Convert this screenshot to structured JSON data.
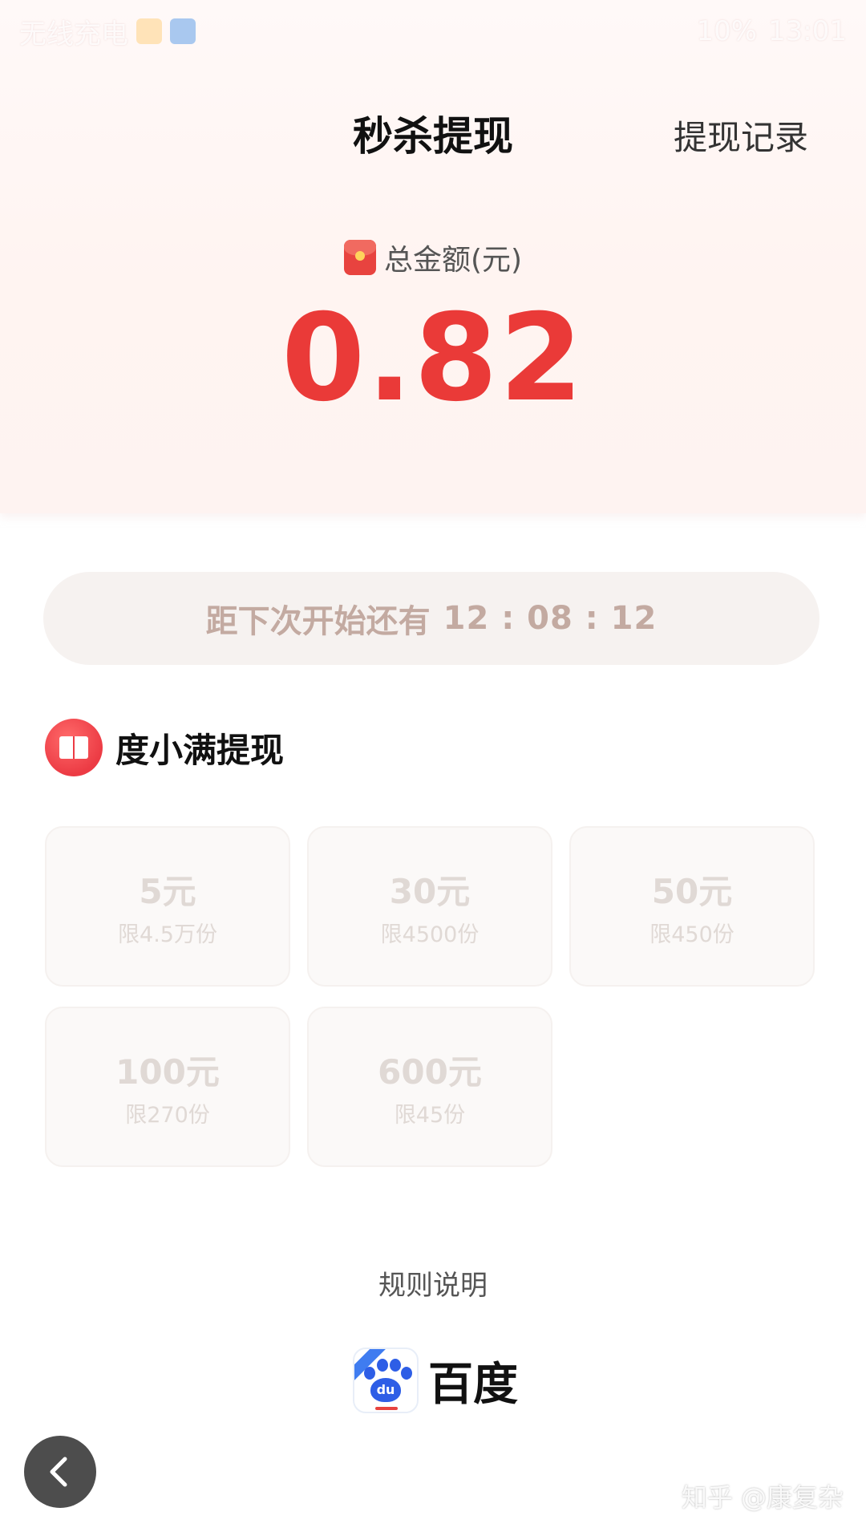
{
  "status_bar": {
    "left_text": "无线充电",
    "right_text": "10%",
    "time": "13:01"
  },
  "header": {
    "title": "秒杀提现",
    "record_link": "提现记录"
  },
  "balance": {
    "label": "总金额(元)",
    "amount": "0.82"
  },
  "countdown": {
    "prefix": "距下次开始还有",
    "time": "12 : 08 : 12"
  },
  "section": {
    "title": "度小满提现"
  },
  "options": [
    {
      "amount": "5元",
      "limit": "限4.5万份"
    },
    {
      "amount": "30元",
      "limit": "限4500份"
    },
    {
      "amount": "50元",
      "limit": "限450份"
    },
    {
      "amount": "100元",
      "limit": "限270份"
    },
    {
      "amount": "600元",
      "limit": "限45份"
    }
  ],
  "footer": {
    "rules": "规则说明",
    "brand": "百度",
    "brand_icon_text": "du",
    "watermark": "知乎 @康复杂"
  },
  "colors": {
    "accent_red": "#ea3a38",
    "countdown_text": "#c3aaa1",
    "disabled_text": "#e0d9d5"
  },
  "icons": {
    "envelope": "red-envelope-icon",
    "book": "book-icon",
    "baidu": "baidu-paw-icon",
    "back": "chevron-left-icon"
  }
}
